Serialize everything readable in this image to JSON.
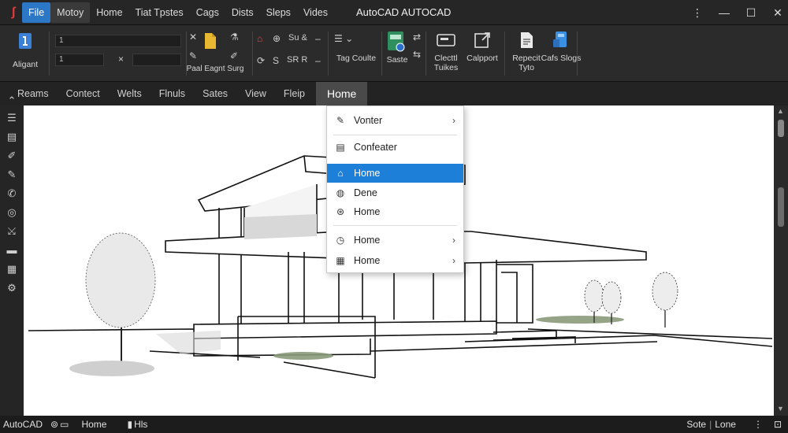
{
  "menubar": {
    "items": [
      "File",
      "Motoy",
      "Home",
      "Tiat Tpstes",
      "Cags",
      "Dists",
      "Sleps",
      "Vides"
    ],
    "title": "AutoCAD AUTOCAD"
  },
  "ribbon": {
    "aligant": "Aligant",
    "field1": "1",
    "field2": "1",
    "paste_label": "Paal Eagnt Surg",
    "tag_label": "Tag Coulte",
    "state_label": "Saste",
    "big_buttons": [
      "Clecttl Tuikes",
      "Calpport",
      "Repecit Tyto",
      "Cafs Slogs"
    ]
  },
  "tabs": [
    "Reams",
    "Contect",
    "Welts",
    "Flnuls",
    "Sates",
    "View",
    "Fleip",
    "Home"
  ],
  "dropdown": {
    "items": [
      {
        "label": "Vonter",
        "icon": "pencil-icon",
        "submenu": true
      },
      {
        "label": "Confeater",
        "icon": "layers-icon",
        "submenu": false
      },
      {
        "label": "Home",
        "icon": "home-icon",
        "submenu": false,
        "selected": true
      },
      {
        "label": "Dene",
        "icon": "globe-icon",
        "submenu": false
      },
      {
        "label": "Home",
        "icon": "settings-icon",
        "submenu": false
      },
      {
        "label": "Home",
        "icon": "clock-icon",
        "submenu": true
      },
      {
        "label": "Home",
        "icon": "grid-icon",
        "submenu": true
      }
    ]
  },
  "statusbar": {
    "app": "AutoCAD",
    "item1": "Home",
    "item2": "Hls",
    "right_label": "Sote",
    "right_label2": "Lone"
  },
  "colors": {
    "accent": "#1e7fd8",
    "file_menu": "#2d78c6",
    "logo": "#e23b3b"
  }
}
